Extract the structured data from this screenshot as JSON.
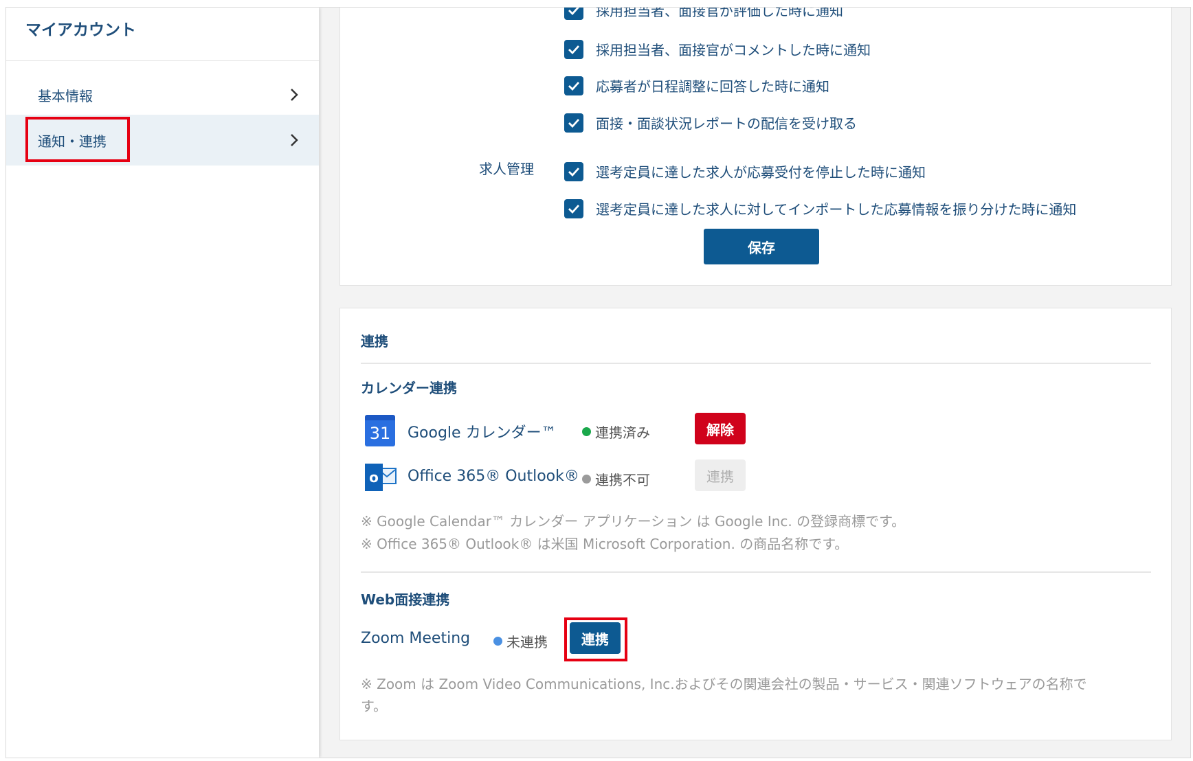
{
  "sidebar": {
    "title": "マイアカウント",
    "items": [
      {
        "label": "基本情報"
      },
      {
        "label": "通知・連携"
      }
    ]
  },
  "notifications": {
    "partial_top_text": "採用担当者、面接官が評価した時に通知",
    "items": [
      "採用担当者、面接官がコメントした時に通知",
      "応募者が日程調整に回答した時に通知",
      "面接・面談状況レポートの配信を受け取る"
    ],
    "job_group_label": "求人管理",
    "job_items": [
      "選考定員に達した求人が応募受付を停止した時に通知",
      "選考定員に達した求人に対してインポートした応募情報を振り分けた時に通知"
    ],
    "save_label": "保存"
  },
  "integration": {
    "title": "連携",
    "calendar": {
      "title": "カレンダー連携",
      "google": {
        "icon_text": "31",
        "name": "Google カレンダー™",
        "status": "連携済み",
        "status_color": "#1aa84b",
        "button": "解除"
      },
      "office": {
        "icon_text": "o",
        "name": "Office 365® Outlook®",
        "status": "連携不可",
        "status_color": "#9b9b9b",
        "button": "連携"
      },
      "notes": [
        "※ Google Calendar™ カレンダー アプリケーション は Google Inc. の登録商標です。",
        "※ Office 365® Outlook® は米国 Microsoft Corporation. の商品名称です。"
      ]
    },
    "web": {
      "title": "Web面接連携",
      "zoom": {
        "name": "Zoom Meeting",
        "status": "未連携",
        "status_color": "#4a90e2",
        "button": "連携"
      },
      "note_lines": [
        "※ Zoom は Zoom Video Communications, Inc.およびその関連会社の製品・サービス・関連ソフトウェアの名称で",
        "す。"
      ]
    }
  },
  "colors": {
    "primary": "#0d5a92",
    "danger": "#d0021b",
    "highlight": "#e60012"
  }
}
